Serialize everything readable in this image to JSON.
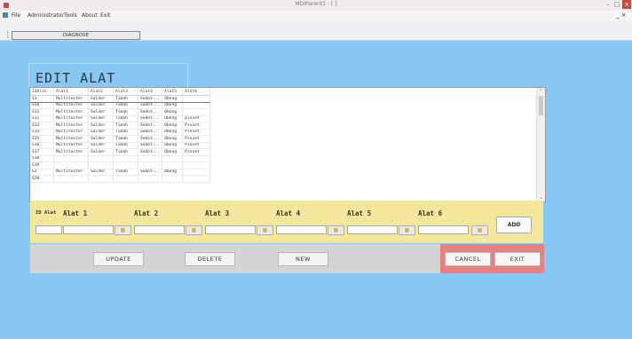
{
  "window": {
    "title": "MDIParent1 - [ ]"
  },
  "menu": {
    "items": [
      "File",
      "Administrator",
      "Tools",
      "About",
      "Exit"
    ],
    "restore_glyph": "_ ×"
  },
  "toolbar": {
    "diagnose_label": "DIAGNOSE"
  },
  "form": {
    "title": "EDIT ALAT"
  },
  "grid": {
    "headers": [
      "IdAlat",
      "Alat1",
      "Alat2",
      "Alat3",
      "Alat4",
      "Alat5",
      "Alat6"
    ],
    "rows": [
      [
        "S1",
        "Multitester",
        "Solder",
        "Timah",
        "Sedot...",
        "Obeng",
        ""
      ],
      [
        "S10",
        "Multitester",
        "Solder",
        "Timah",
        "Sedot...",
        "Obeng",
        ""
      ],
      [
        "S11",
        "Multitester",
        "Solder",
        "Timah",
        "Sedot...",
        "Obeng",
        ""
      ],
      [
        "S12",
        "Multitester",
        "Solder",
        "Timah",
        "Sedot...",
        "Obeng",
        "pinset"
      ],
      [
        "S13",
        "Multitester",
        "Solder",
        "Timah",
        "Sedot...",
        "Obeng",
        "Pinset"
      ],
      [
        "S14",
        "Multitester",
        "Solder",
        "Timah",
        "Sedot...",
        "Obeng",
        "Pinset"
      ],
      [
        "S15",
        "Multitester",
        "Solder",
        "Timah",
        "Sedot...",
        "Obeng",
        "Pinset"
      ],
      [
        "S16",
        "Multitester",
        "Solder",
        "Timah",
        "Sedot...",
        "Obeng",
        "Pinset"
      ],
      [
        "S17",
        "Multitester",
        "Solder",
        "Timah",
        "Sedot...",
        "Obeng",
        "Pinset"
      ],
      [
        "S18",
        "",
        "",
        "",
        "",
        "",
        ""
      ],
      [
        "S19",
        "",
        "",
        "",
        "",
        "",
        ""
      ],
      [
        "S2",
        "Multitester",
        "Solder",
        "Timah",
        "Sedot...",
        "Obeng",
        ""
      ],
      [
        "S20",
        "",
        "",
        "",
        "",
        "",
        ""
      ]
    ]
  },
  "inputs": {
    "id_label": "ID Alat",
    "alat_labels": [
      "Alat 1",
      "Alat 2",
      "Alat 3",
      "Alat 4",
      "Alat 5",
      "Alat 6"
    ],
    "add_label": "ADD"
  },
  "actions": {
    "update": "UPDATE",
    "delete": "DELETE",
    "new": "NEW",
    "cancel": "CANCEL",
    "exit": "EXIT"
  },
  "colors": {
    "background": "#88c8f4",
    "input_panel": "#f4e69a",
    "action_panel": "#d4d4d4",
    "exit_panel": "#e98080"
  },
  "icons": {
    "app": "form-icon",
    "mdi": "mdi-icon",
    "browse": "folder-open-icon"
  }
}
